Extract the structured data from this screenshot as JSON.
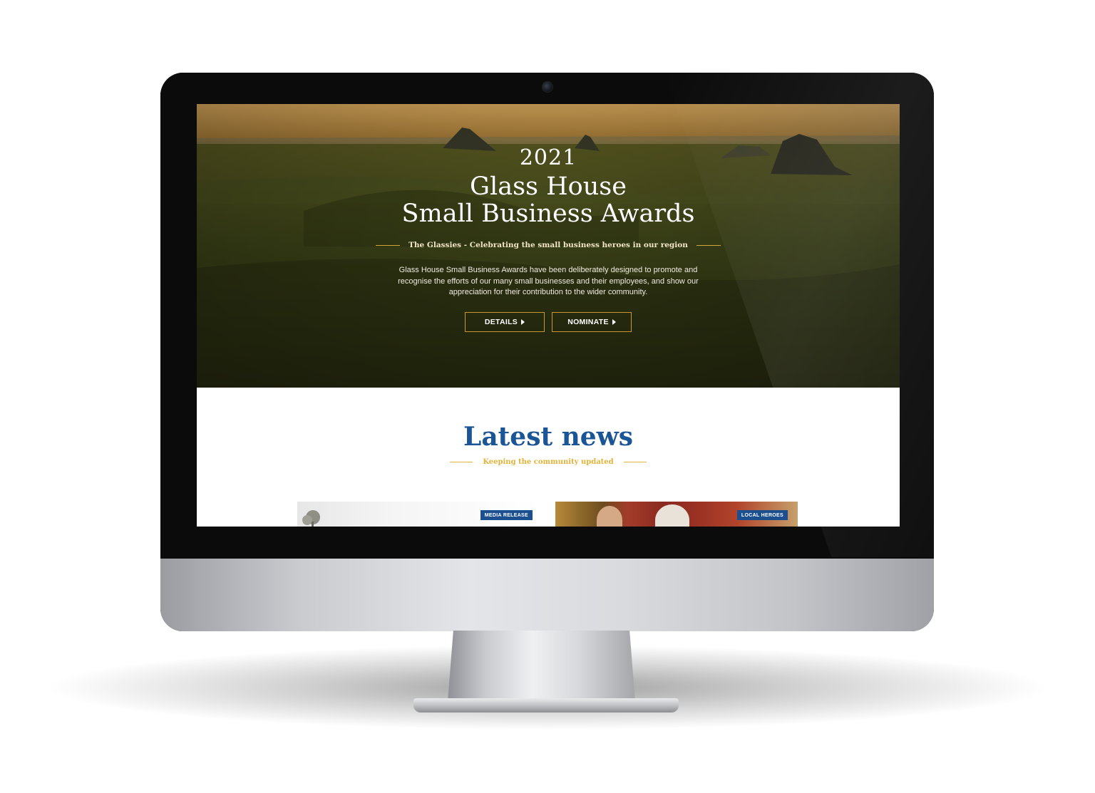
{
  "hero": {
    "year": "2021",
    "title_line1": "Glass House",
    "title_line2": "Small Business Awards",
    "tagline": "The Glassies - Celebrating the small business heroes in our region",
    "description": "Glass House Small Business Awards have been deliberately designed to promote and recognise the efforts of our many small businesses and their employees, and show our appreciation for their contribution to the wider community.",
    "buttons": [
      {
        "label": "DETAILS",
        "icon": "caret-right-icon"
      },
      {
        "label": "NOMINATE",
        "icon": "caret-right-icon"
      }
    ]
  },
  "news": {
    "heading": "Latest news",
    "subheading": "Keeping the community updated",
    "cards": [
      {
        "badge": "MEDIA RELEASE"
      },
      {
        "badge": "LOCAL HEROES"
      }
    ]
  },
  "colors": {
    "brand_blue": "#1b5596",
    "gold": "#d4a53a",
    "badge_blue": "#1b4f8f"
  }
}
